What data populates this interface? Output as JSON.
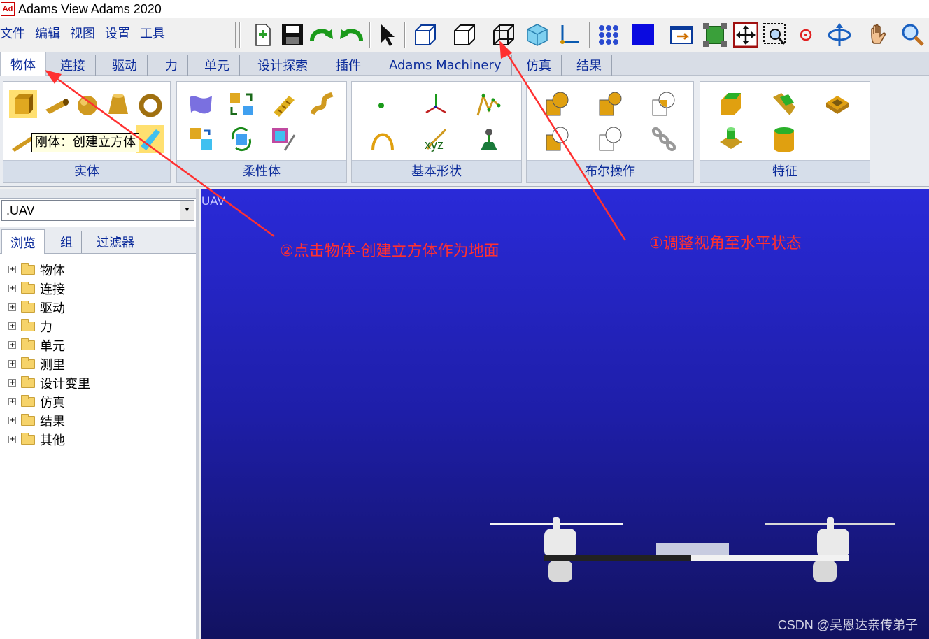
{
  "window": {
    "logo": "Ad",
    "title": "Adams View Adams 2020"
  },
  "menu": [
    "文件",
    "编辑",
    "视图",
    "设置",
    "工具"
  ],
  "tabs": [
    "物体",
    "连接",
    "驱动",
    "力",
    "单元",
    "设计探索",
    "插件",
    "Adams Machinery",
    "仿真",
    "结果"
  ],
  "ribbon": {
    "groups": [
      "实体",
      "柔性体",
      "基本形状",
      "布尔操作",
      "特征"
    ],
    "xyz_label": "xyz",
    "tooltip": "刚体：创建立方体"
  },
  "left_panel": {
    "model": ".UAV",
    "subtabs": [
      "浏览",
      "组",
      "过滤器"
    ],
    "tree": [
      "物体",
      "连接",
      "驱动",
      "力",
      "单元",
      "测里",
      "设计变里",
      "仿真",
      "结果",
      "其他"
    ]
  },
  "viewport": {
    "label": "UAV",
    "watermark": "CSDN @吴恩达亲传弟子"
  },
  "annotations": {
    "step1": "①调整视角至水平状态",
    "step2": "②点击物体-创建立方体作为地面",
    "color": "#ff3030"
  },
  "colors": {
    "viewport_top": "#2a2ad8",
    "viewport_bottom": "#121260",
    "menu_text": "#0a2a9a"
  }
}
